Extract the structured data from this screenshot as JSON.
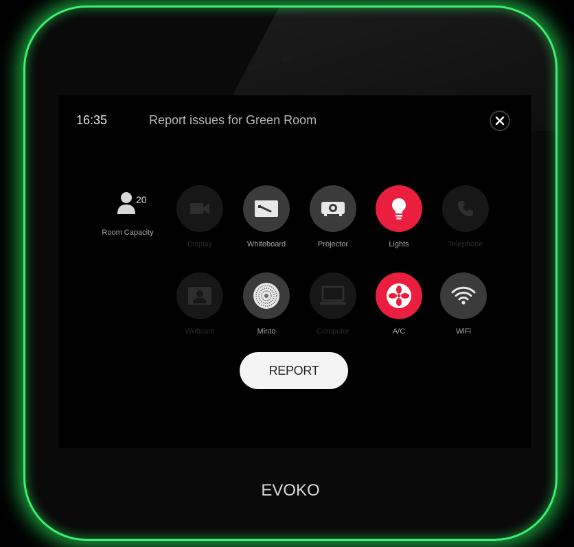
{
  "header": {
    "time": "16:35",
    "title": "Report issues for Green Room"
  },
  "capacity": {
    "count": "20",
    "label": "Room Capacity"
  },
  "equipment": [
    {
      "label": "Display",
      "icon": "video-camera-icon",
      "state": "unavailable"
    },
    {
      "label": "Whiteboard",
      "icon": "whiteboard-icon",
      "state": "available"
    },
    {
      "label": "Projector",
      "icon": "projector-icon",
      "state": "available"
    },
    {
      "label": "Lights",
      "icon": "lightbulb-icon",
      "state": "selected"
    },
    {
      "label": "Telephone",
      "icon": "telephone-icon",
      "state": "unavailable"
    },
    {
      "label": "Webcam",
      "icon": "webcam-icon",
      "state": "unavailable"
    },
    {
      "label": "Minto",
      "icon": "speaker-icon",
      "state": "available"
    },
    {
      "label": "Computer",
      "icon": "laptop-icon",
      "state": "unavailable"
    },
    {
      "label": "A/C",
      "icon": "fan-icon",
      "state": "selected"
    },
    {
      "label": "WiFi",
      "icon": "wifi-icon",
      "state": "available"
    }
  ],
  "actions": {
    "report_label": "REPORT"
  },
  "device": {
    "brand": "EVOKO"
  },
  "colors": {
    "selected": "#ea1f3f",
    "available": "#3b3b3b",
    "unavailable": "#171717",
    "glow": "#3cf070"
  }
}
